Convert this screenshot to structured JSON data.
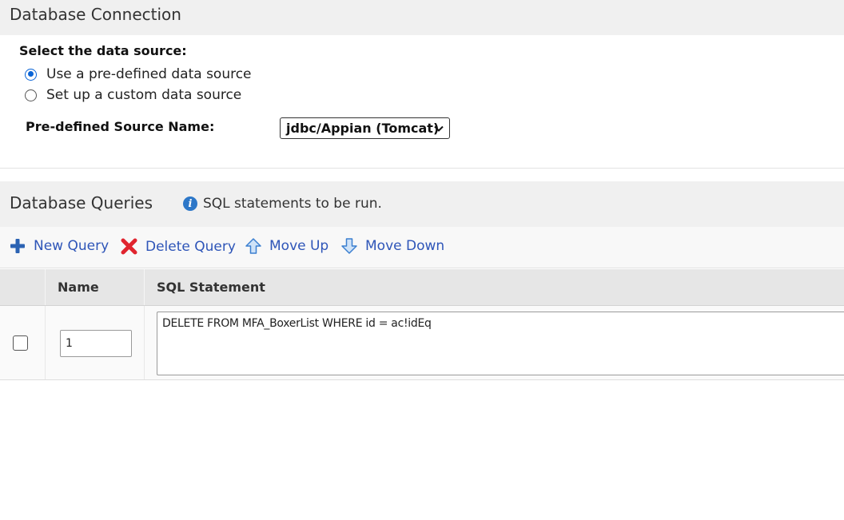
{
  "connection": {
    "section_title": "Database Connection",
    "select_label": "Select the data source:",
    "options": [
      {
        "label": "Use a pre-defined data source",
        "selected": true
      },
      {
        "label": "Set up a custom data source",
        "selected": false
      }
    ],
    "source_name_label": "Pre-defined Source Name:",
    "source_name_value": "jdbc/Appian (Tomcat)"
  },
  "queries": {
    "section_title": "Database Queries",
    "info_text": "SQL statements to be run.",
    "toolbar": {
      "new_query": "New Query",
      "delete_query": "Delete Query",
      "move_up": "Move Up",
      "move_down": "Move Down"
    },
    "columns": {
      "name": "Name",
      "sql": "SQL Statement"
    },
    "rows": [
      {
        "checked": false,
        "name": "1",
        "sql": "DELETE FROM MFA_BoxerList WHERE id = ac!idEq"
      }
    ]
  },
  "colors": {
    "accent_blue": "#0a64d6",
    "link_blue": "#2e55b8",
    "delete_red": "#e0242e",
    "header_bg": "#f0f0f0"
  },
  "icons": {
    "new_query": "plus-icon",
    "delete_query": "x-icon",
    "move_up": "arrow-up-icon",
    "move_down": "arrow-down-icon",
    "info": "info-icon",
    "select": "chevron-down-icon"
  }
}
